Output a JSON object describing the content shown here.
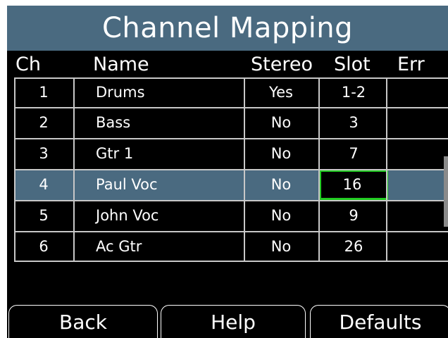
{
  "title": "Channel Mapping",
  "columns": {
    "ch": "Ch",
    "name": "Name",
    "stereo": "Stereo",
    "slot": "Slot",
    "err": "Err"
  },
  "rows": [
    {
      "ch": "1",
      "name": "Drums",
      "stereo": "Yes",
      "slot": "1-2",
      "err": ""
    },
    {
      "ch": "2",
      "name": "Bass",
      "stereo": "No",
      "slot": "3",
      "err": ""
    },
    {
      "ch": "3",
      "name": "Gtr 1",
      "stereo": "No",
      "slot": "7",
      "err": ""
    },
    {
      "ch": "4",
      "name": "Paul Voc",
      "stereo": "No",
      "slot": "16",
      "err": ""
    },
    {
      "ch": "5",
      "name": "John Voc",
      "stereo": "No",
      "slot": "9",
      "err": ""
    },
    {
      "ch": "6",
      "name": "Ac Gtr",
      "stereo": "No",
      "slot": "26",
      "err": ""
    }
  ],
  "selected_row": "4",
  "softkeys": {
    "back": "Back",
    "help": "Help",
    "defaults": "Defaults"
  },
  "colors": {
    "title_bg": "#4a6a80",
    "selected_row_bg": "#4a6a80",
    "edit_highlight": "#22cc22",
    "background": "#000000",
    "text": "#ffffff"
  }
}
